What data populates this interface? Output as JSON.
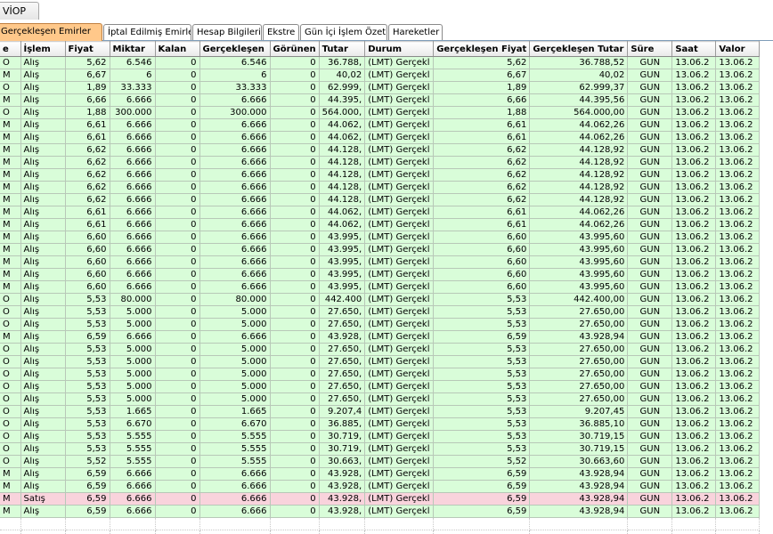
{
  "window": {
    "top_tab": "VİOP"
  },
  "tabs": [
    "Gerçekleşen Emirler",
    "İptal Edilmiş Emirler",
    "Hesap Bilgileri",
    "Ekstre",
    "Gün İçi İşlem Özeti",
    "Hareketler"
  ],
  "active_tab": 0,
  "colors": {
    "buy_row": "#d9fdd9",
    "sell_row": "#f9d3dc",
    "active_tab": "#ffc88a"
  },
  "columns": [
    "e",
    "İşlem",
    "Fiyat",
    "Miktar",
    "Kalan",
    "Gerçekleşen",
    "Görünen",
    "Tutar",
    "Durum",
    "Gerçekleşen Fiyat",
    "Gerçekleşen Tutar",
    "Süre",
    "Saat",
    "Valor"
  ],
  "rows": [
    [
      "O",
      "Alış",
      "5,62",
      "6.546",
      "0",
      "6.546",
      "0",
      "36.788,",
      "(LMT) Gerçekl",
      "5,62",
      "36.788,52",
      "GUN",
      "13.06.2",
      "13.06.2"
    ],
    [
      "M",
      "Alış",
      "6,67",
      "6",
      "0",
      "6",
      "0",
      "40,02",
      "(LMT) Gerçekl",
      "6,67",
      "40,02",
      "GUN",
      "13.06.2",
      "13.06.2"
    ],
    [
      "O",
      "Alış",
      "1,89",
      "33.333",
      "0",
      "33.333",
      "0",
      "62.999,",
      "(LMT) Gerçekl",
      "1,89",
      "62.999,37",
      "GUN",
      "13.06.2",
      "13.06.2"
    ],
    [
      "M",
      "Alış",
      "6,66",
      "6.666",
      "0",
      "6.666",
      "0",
      "44.395,",
      "(LMT) Gerçekl",
      "6,66",
      "44.395,56",
      "GUN",
      "13.06.2",
      "13.06.2"
    ],
    [
      "O",
      "Alış",
      "1,88",
      "300.000",
      "0",
      "300.000",
      "0",
      "564.000,",
      "(LMT) Gerçekl",
      "1,88",
      "564.000,00",
      "GUN",
      "13.06.2",
      "13.06.2"
    ],
    [
      "M",
      "Alış",
      "6,61",
      "6.666",
      "0",
      "6.666",
      "0",
      "44.062,",
      "(LMT) Gerçekl",
      "6,61",
      "44.062,26",
      "GUN",
      "13.06.2",
      "13.06.2"
    ],
    [
      "M",
      "Alış",
      "6,61",
      "6.666",
      "0",
      "6.666",
      "0",
      "44.062,",
      "(LMT) Gerçekl",
      "6,61",
      "44.062,26",
      "GUN",
      "13.06.2",
      "13.06.2"
    ],
    [
      "M",
      "Alış",
      "6,62",
      "6.666",
      "0",
      "6.666",
      "0",
      "44.128,",
      "(LMT) Gerçekl",
      "6,62",
      "44.128,92",
      "GUN",
      "13.06.2",
      "13.06.2"
    ],
    [
      "M",
      "Alış",
      "6,62",
      "6.666",
      "0",
      "6.666",
      "0",
      "44.128,",
      "(LMT) Gerçekl",
      "6,62",
      "44.128,92",
      "GUN",
      "13.06.2",
      "13.06.2"
    ],
    [
      "M",
      "Alış",
      "6,62",
      "6.666",
      "0",
      "6.666",
      "0",
      "44.128,",
      "(LMT) Gerçekl",
      "6,62",
      "44.128,92",
      "GUN",
      "13.06.2",
      "13.06.2"
    ],
    [
      "M",
      "Alış",
      "6,62",
      "6.666",
      "0",
      "6.666",
      "0",
      "44.128,",
      "(LMT) Gerçekl",
      "6,62",
      "44.128,92",
      "GUN",
      "13.06.2",
      "13.06.2"
    ],
    [
      "M",
      "Alış",
      "6,62",
      "6.666",
      "0",
      "6.666",
      "0",
      "44.128,",
      "(LMT) Gerçekl",
      "6,62",
      "44.128,92",
      "GUN",
      "13.06.2",
      "13.06.2"
    ],
    [
      "M",
      "Alış",
      "6,61",
      "6.666",
      "0",
      "6.666",
      "0",
      "44.062,",
      "(LMT) Gerçekl",
      "6,61",
      "44.062,26",
      "GUN",
      "13.06.2",
      "13.06.2"
    ],
    [
      "M",
      "Alış",
      "6,61",
      "6.666",
      "0",
      "6.666",
      "0",
      "44.062,",
      "(LMT) Gerçekl",
      "6,61",
      "44.062,26",
      "GUN",
      "13.06.2",
      "13.06.2"
    ],
    [
      "M",
      "Alış",
      "6,60",
      "6.666",
      "0",
      "6.666",
      "0",
      "43.995,",
      "(LMT) Gerçekl",
      "6,60",
      "43.995,60",
      "GUN",
      "13.06.2",
      "13.06.2"
    ],
    [
      "M",
      "Alış",
      "6,60",
      "6.666",
      "0",
      "6.666",
      "0",
      "43.995,",
      "(LMT) Gerçekl",
      "6,60",
      "43.995,60",
      "GUN",
      "13.06.2",
      "13.06.2"
    ],
    [
      "M",
      "Alış",
      "6,60",
      "6.666",
      "0",
      "6.666",
      "0",
      "43.995,",
      "(LMT) Gerçekl",
      "6,60",
      "43.995,60",
      "GUN",
      "13.06.2",
      "13.06.2"
    ],
    [
      "M",
      "Alış",
      "6,60",
      "6.666",
      "0",
      "6.666",
      "0",
      "43.995,",
      "(LMT) Gerçekl",
      "6,60",
      "43.995,60",
      "GUN",
      "13.06.2",
      "13.06.2"
    ],
    [
      "M",
      "Alış",
      "6,60",
      "6.666",
      "0",
      "6.666",
      "0",
      "43.995,",
      "(LMT) Gerçekl",
      "6,60",
      "43.995,60",
      "GUN",
      "13.06.2",
      "13.06.2"
    ],
    [
      "O",
      "Alış",
      "5,53",
      "80.000",
      "0",
      "80.000",
      "0",
      "442.400",
      "(LMT) Gerçekl",
      "5,53",
      "442.400,00",
      "GUN",
      "13.06.2",
      "13.06.2"
    ],
    [
      "O",
      "Alış",
      "5,53",
      "5.000",
      "0",
      "5.000",
      "0",
      "27.650,",
      "(LMT) Gerçekl",
      "5,53",
      "27.650,00",
      "GUN",
      "13.06.2",
      "13.06.2"
    ],
    [
      "O",
      "Alış",
      "5,53",
      "5.000",
      "0",
      "5.000",
      "0",
      "27.650,",
      "(LMT) Gerçekl",
      "5,53",
      "27.650,00",
      "GUN",
      "13.06.2",
      "13.06.2"
    ],
    [
      "M",
      "Alış",
      "6,59",
      "6.666",
      "0",
      "6.666",
      "0",
      "43.928,",
      "(LMT) Gerçekl",
      "6,59",
      "43.928,94",
      "GUN",
      "13.06.2",
      "13.06.2"
    ],
    [
      "O",
      "Alış",
      "5,53",
      "5.000",
      "0",
      "5.000",
      "0",
      "27.650,",
      "(LMT) Gerçekl",
      "5,53",
      "27.650,00",
      "GUN",
      "13.06.2",
      "13.06.2"
    ],
    [
      "O",
      "Alış",
      "5,53",
      "5.000",
      "0",
      "5.000",
      "0",
      "27.650,",
      "(LMT) Gerçekl",
      "5,53",
      "27.650,00",
      "GUN",
      "13.06.2",
      "13.06.2"
    ],
    [
      "O",
      "Alış",
      "5,53",
      "5.000",
      "0",
      "5.000",
      "0",
      "27.650,",
      "(LMT) Gerçekl",
      "5,53",
      "27.650,00",
      "GUN",
      "13.06.2",
      "13.06.2"
    ],
    [
      "O",
      "Alış",
      "5,53",
      "5.000",
      "0",
      "5.000",
      "0",
      "27.650,",
      "(LMT) Gerçekl",
      "5,53",
      "27.650,00",
      "GUN",
      "13.06.2",
      "13.06.2"
    ],
    [
      "O",
      "Alış",
      "5,53",
      "5.000",
      "0",
      "5.000",
      "0",
      "27.650,",
      "(LMT) Gerçekl",
      "5,53",
      "27.650,00",
      "GUN",
      "13.06.2",
      "13.06.2"
    ],
    [
      "O",
      "Alış",
      "5,53",
      "1.665",
      "0",
      "1.665",
      "0",
      "9.207,4",
      "(LMT) Gerçekl",
      "5,53",
      "9.207,45",
      "GUN",
      "13.06.2",
      "13.06.2"
    ],
    [
      "O",
      "Alış",
      "5,53",
      "6.670",
      "0",
      "6.670",
      "0",
      "36.885,",
      "(LMT) Gerçekl",
      "5,53",
      "36.885,10",
      "GUN",
      "13.06.2",
      "13.06.2"
    ],
    [
      "O",
      "Alış",
      "5,53",
      "5.555",
      "0",
      "5.555",
      "0",
      "30.719,",
      "(LMT) Gerçekl",
      "5,53",
      "30.719,15",
      "GUN",
      "13.06.2",
      "13.06.2"
    ],
    [
      "O",
      "Alış",
      "5,53",
      "5.555",
      "0",
      "5.555",
      "0",
      "30.719,",
      "(LMT) Gerçekl",
      "5,53",
      "30.719,15",
      "GUN",
      "13.06.2",
      "13.06.2"
    ],
    [
      "O",
      "Alış",
      "5,52",
      "5.555",
      "0",
      "5.555",
      "0",
      "30.663,",
      "(LMT) Gerçekl",
      "5,52",
      "30.663,60",
      "GUN",
      "13.06.2",
      "13.06.2"
    ],
    [
      "M",
      "Alış",
      "6,59",
      "6.666",
      "0",
      "6.666",
      "0",
      "43.928,",
      "(LMT) Gerçekl",
      "6,59",
      "43.928,94",
      "GUN",
      "13.06.2",
      "13.06.2"
    ],
    [
      "M",
      "Alış",
      "6,59",
      "6.666",
      "0",
      "6.666",
      "0",
      "43.928,",
      "(LMT) Gerçekl",
      "6,59",
      "43.928,94",
      "GUN",
      "13.06.2",
      "13.06.2"
    ],
    [
      "M",
      "Satış",
      "6,59",
      "6.666",
      "0",
      "6.666",
      "0",
      "43.928,",
      "(LMT) Gerçekl",
      "6,59",
      "43.928,94",
      "GUN",
      "13.06.2",
      "13.06.2"
    ],
    [
      "M",
      "Alış",
      "6,59",
      "6.666",
      "0",
      "6.666",
      "0",
      "43.928,",
      "(LMT) Gerçekl",
      "6,59",
      "43.928,94",
      "GUN",
      "13.06.2",
      "13.06.2"
    ]
  ]
}
